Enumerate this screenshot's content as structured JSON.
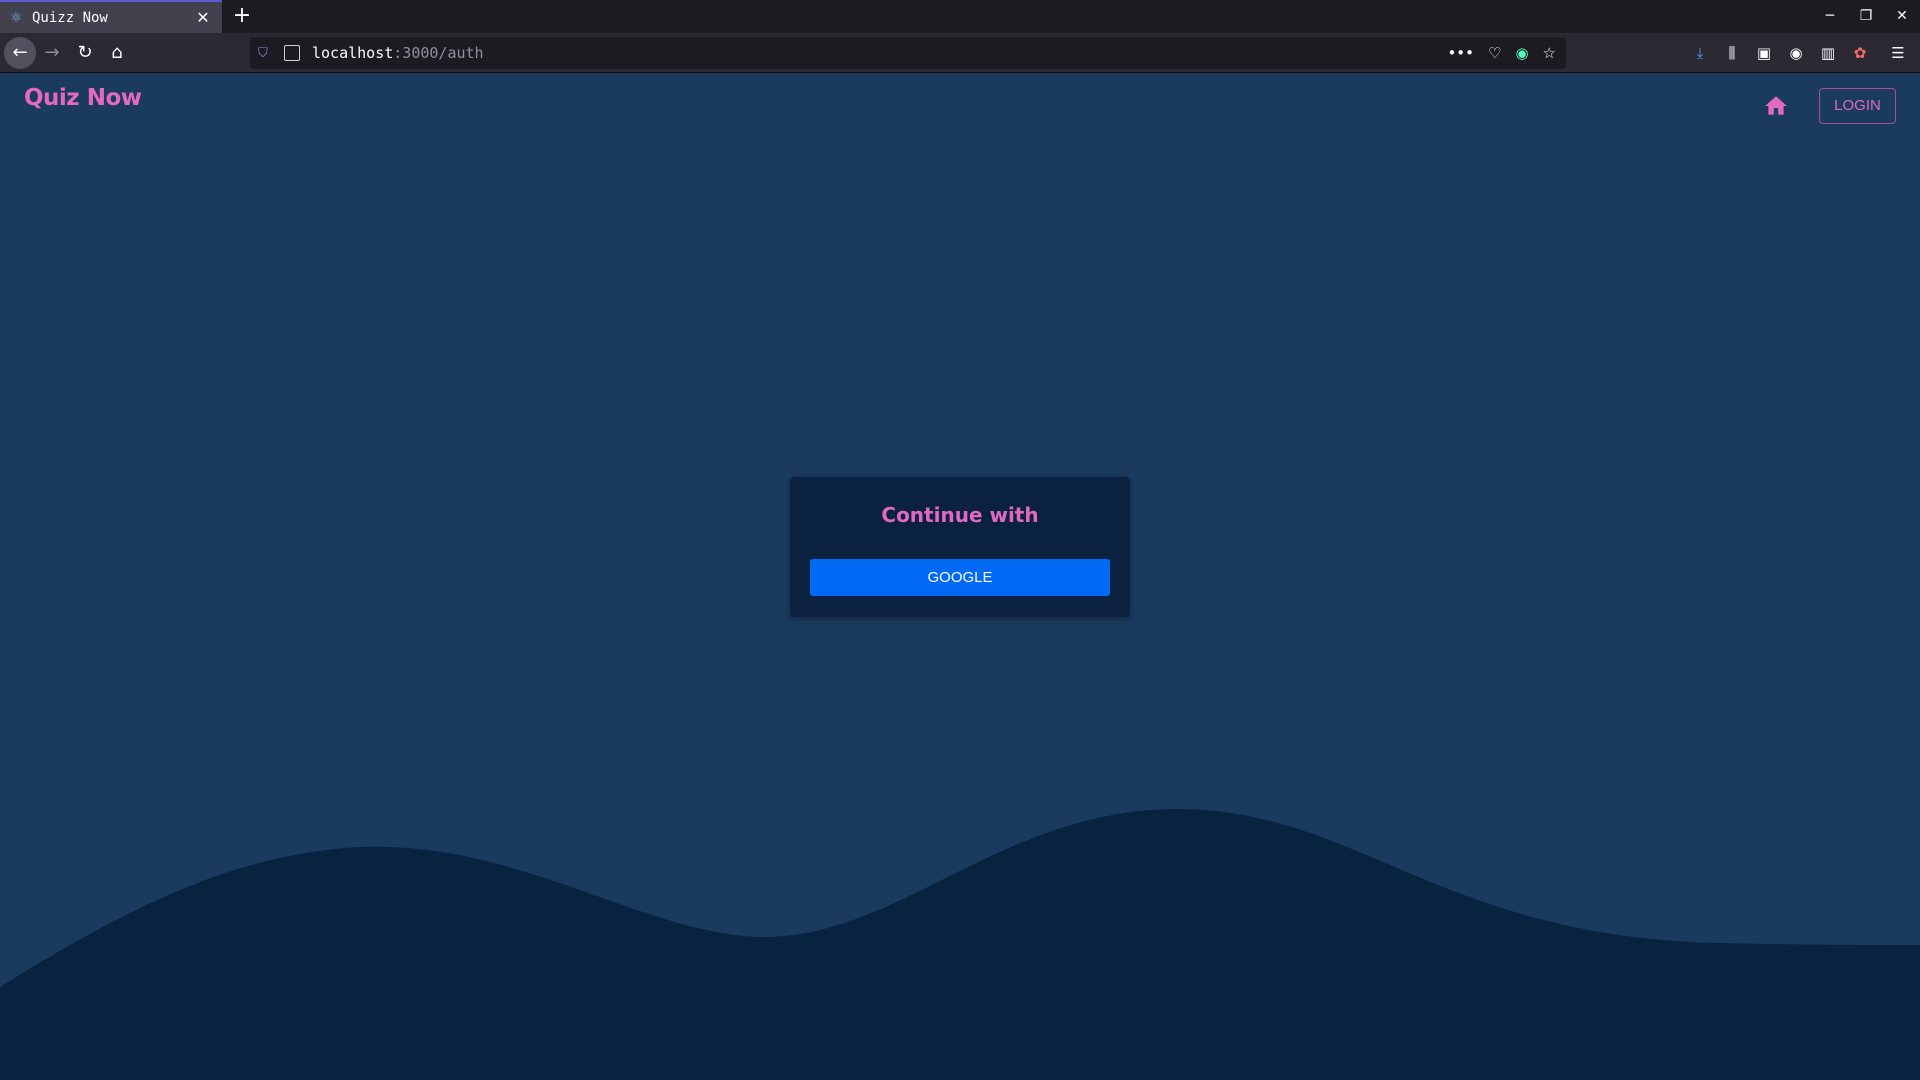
{
  "browser": {
    "tab_title": "Quizz Now",
    "url_host": "localhost",
    "url_path": ":3000/auth"
  },
  "app": {
    "brand": "Quiz Now",
    "login_label": "LOGIN",
    "home_icon": "home-icon"
  },
  "auth_card": {
    "title": "Continue with",
    "google_label": "GOOGLE"
  },
  "colors": {
    "accent_pink": "#e369c0",
    "page_bg": "#1a3a5e",
    "wave_dark": "#072340",
    "google_blue": "#006af5"
  }
}
